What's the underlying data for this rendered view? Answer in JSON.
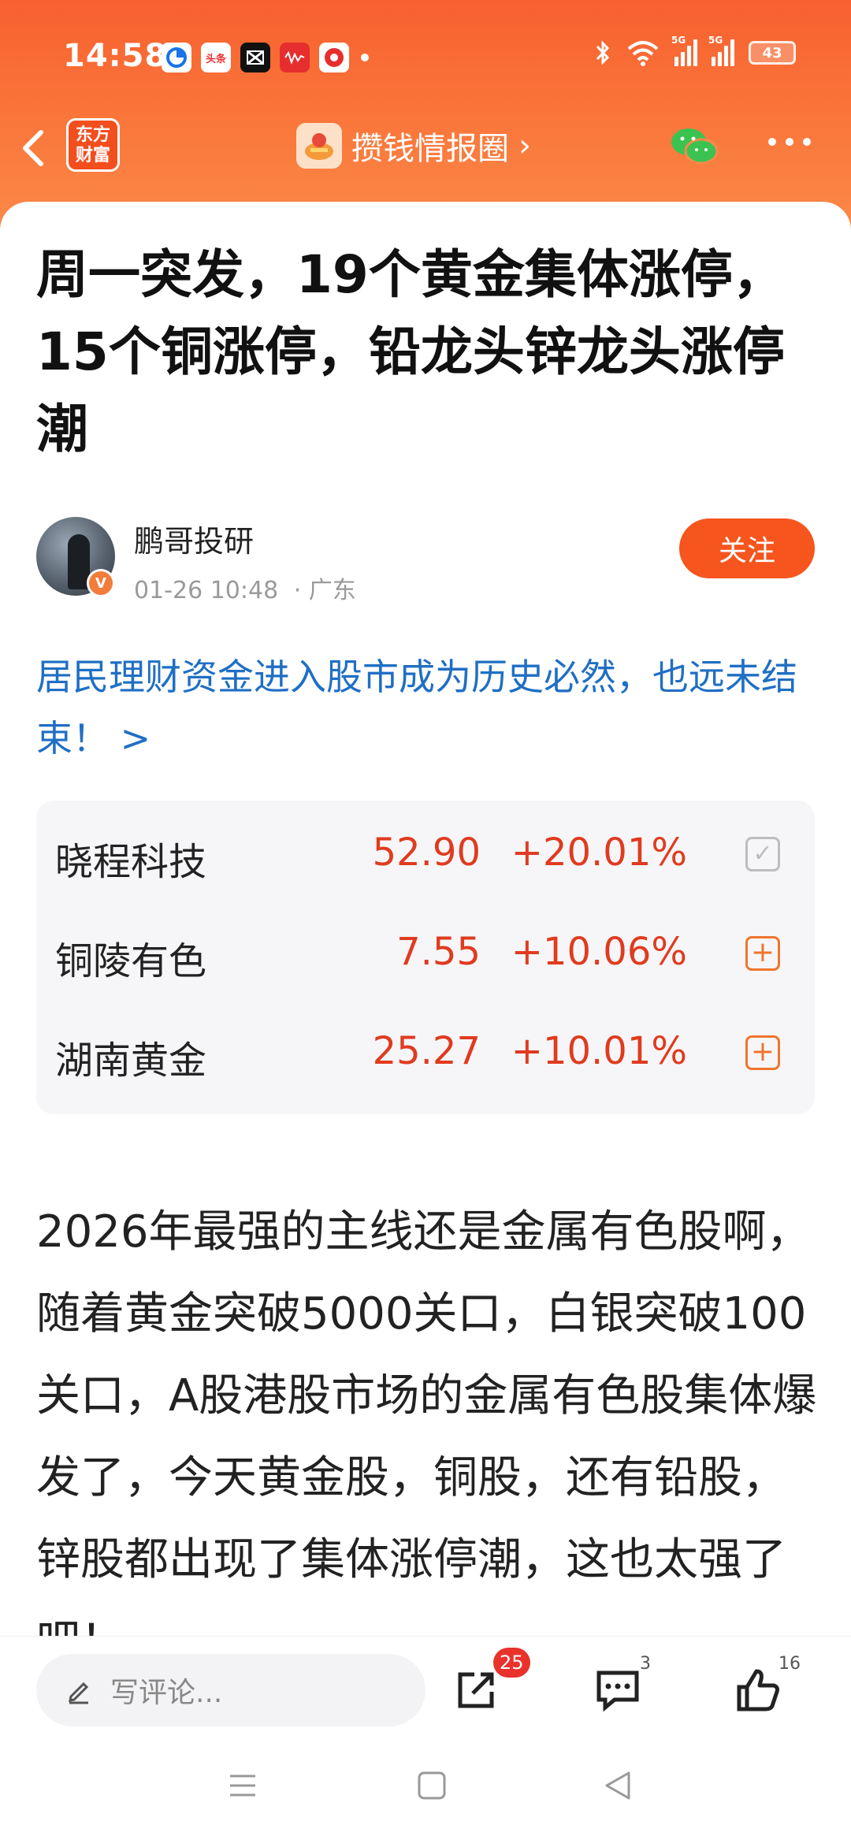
{
  "status_bar": {
    "time": "14:58",
    "apps": [
      "browser-app-icon",
      "toutiao-app-icon",
      "capcut-app-icon",
      "music-app-icon",
      "reward-app-icon"
    ],
    "app_labels": {
      "toutiao": "头条"
    },
    "battery": "43",
    "network_labels": [
      "5G",
      "5G"
    ]
  },
  "nav": {
    "logo_text": "东方财富",
    "circle_name": "攒钱情报圈",
    "circle_chevron": "›"
  },
  "article": {
    "title": "周一突发，19个黄金集体涨停，15个铜涨停，铅龙头锌龙头涨停潮",
    "author": {
      "name": "鹏哥投研",
      "verified_badge": "V",
      "time": "01-26 10:48",
      "location": "· 广东"
    },
    "follow_label": "关注",
    "promo_text": "居民理财资金进入股市成为历史必然，也远未结束！ >",
    "stocks": [
      {
        "name": "晓程科技",
        "price": "52.90",
        "change": "+20.01%",
        "action": "checked"
      },
      {
        "name": "铜陵有色",
        "price": "7.55",
        "change": "+10.06%",
        "action": "add"
      },
      {
        "name": "湖南黄金",
        "price": "25.27",
        "change": "+10.01%",
        "action": "add"
      }
    ],
    "body": "2026年最强的主线还是金属有色股啊，随着黄金突破5000关口，白银突破100关口，A股港股市场的金属有色股集体爆发了，今天黄金股，铜股，还有铅股，锌股都出现了集体涨停潮，这也太强了吧！"
  },
  "bottom_bar": {
    "comment_placeholder": "写评论...",
    "share_count": "25",
    "comment_count": "3",
    "like_count": "16"
  },
  "colors": {
    "accent": "#f6551e",
    "price_red": "#e03b1f",
    "link_blue": "#1f6fc4"
  }
}
